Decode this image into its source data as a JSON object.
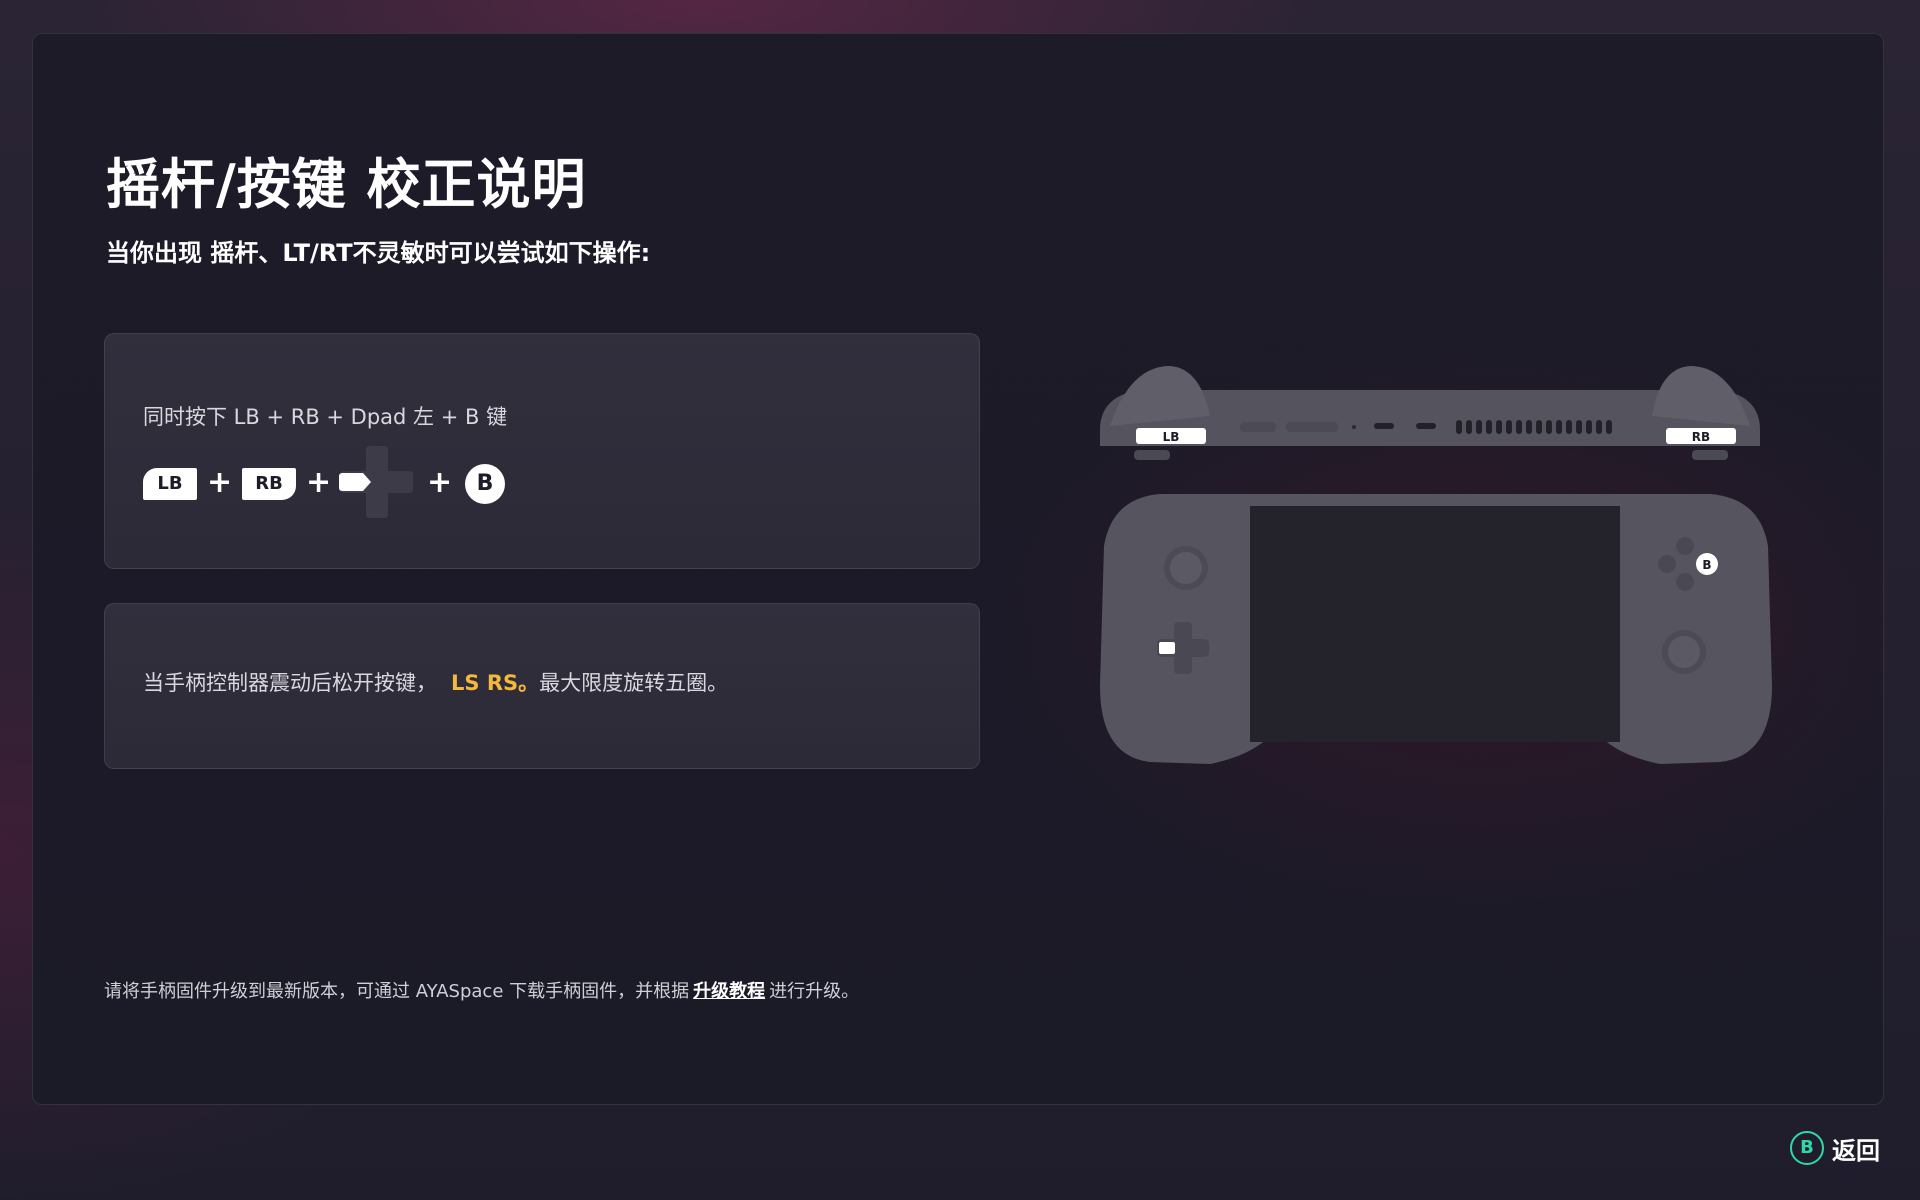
{
  "page": {
    "title": "摇杆/按键 校正说明",
    "subtitle": "当你出现 摇杆、LT/RT不灵敏时可以尝试如下操作:"
  },
  "step1": {
    "text": "同时按下 LB + RB + Dpad 左 + B 键",
    "keys": {
      "lb": "LB",
      "rb": "RB",
      "b": "B",
      "plus": "+"
    }
  },
  "step2": {
    "text": "当手柄控制器震动后松开按键，",
    "highlight": "LS RS。",
    "text_after": "最大限度旋转五圈。",
    "highlight_color": "#f4b93b"
  },
  "footer": {
    "text_before": "请将手柄固件升级到最新版本，可通过 AYASpace 下载手柄固件，并根据",
    "link": "升级教程",
    "text_after": "进行升级。"
  },
  "device": {
    "lb_label": "LB",
    "rb_label": "RB",
    "b_label": "B"
  },
  "back": {
    "icon": "B",
    "label": "返回",
    "accent_color": "#2fd8a5"
  },
  "icons": [
    "dpad-left-icon",
    "b-button-icon",
    "device-illustration",
    "back-b-icon"
  ]
}
